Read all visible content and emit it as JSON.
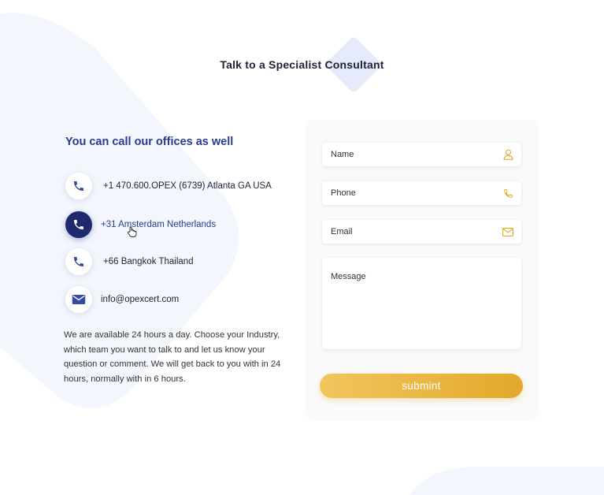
{
  "header": {
    "title": "Talk to a Specialist Consultant"
  },
  "offices": {
    "heading": "You can call our offices as well",
    "contacts": [
      {
        "text": "+1 470.600.OPEX (6739) Atlanta GA USA",
        "icon": "phone-icon"
      },
      {
        "text": "+31 Amsterdam Netherlands",
        "icon": "phone-icon",
        "state": "hovered"
      },
      {
        "text": "+66 Bangkok Thailand",
        "icon": "phone-icon"
      },
      {
        "text": "info@opexcert.com",
        "icon": "mail-icon"
      }
    ],
    "availability": "We are available 24 hours a day. Choose your Industry, which team you want to talk to and let us know your question or comment. We will get back to you with in 24 hours, normally with in 6 hours."
  },
  "form": {
    "name_placeholder": "Name",
    "phone_placeholder": "Phone",
    "email_placeholder": "Email",
    "message_placeholder": "Message",
    "submit_label": "submint"
  },
  "colors": {
    "accent_gold": "#e2a92a",
    "navy": "#1f2a6e",
    "heading_blue": "#2a3b8f",
    "icon_blue": "#3a4aa0",
    "blob": "#f4f6fd"
  }
}
